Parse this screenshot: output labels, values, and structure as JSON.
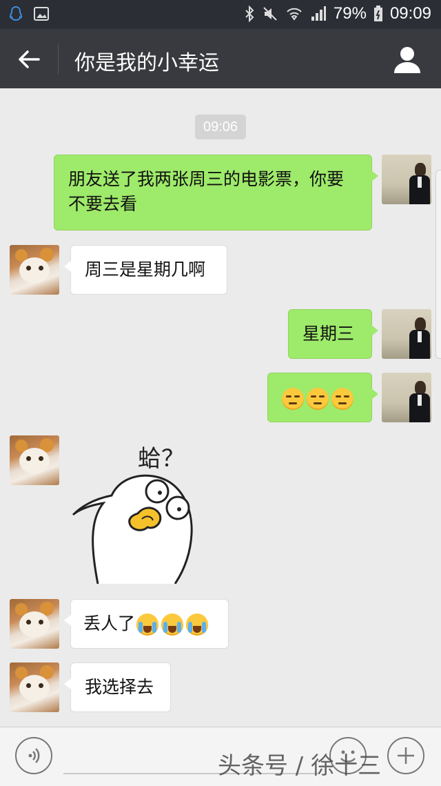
{
  "status_bar": {
    "battery": "79%",
    "time": "09:09",
    "icons": [
      "qq-icon",
      "image-icon",
      "bluetooth-icon",
      "mute-icon",
      "wifi-icon",
      "signal-icon",
      "battery-icon"
    ]
  },
  "header": {
    "title": "你是我的小幸运"
  },
  "chat": {
    "timestamp": "09:06",
    "messages": [
      {
        "side": "out",
        "text": "朋友送了我两张周三的电影票，你要不要去看"
      },
      {
        "side": "in",
        "text": "周三是星期几啊"
      },
      {
        "side": "out",
        "text": "星期三"
      },
      {
        "side": "out",
        "emoji": [
          "unamused-emoji",
          "unamused-emoji",
          "unamused-emoji"
        ]
      },
      {
        "side": "in",
        "sticker": "duck-sticker",
        "sticker_text": "蛤？"
      },
      {
        "side": "in",
        "text": "丢人了",
        "emoji": [
          "crying-laughing-emoji",
          "crying-laughing-emoji",
          "crying-laughing-emoji"
        ]
      },
      {
        "side": "in",
        "text": "我选择去"
      }
    ]
  },
  "bottom_bar": {
    "watermark": "头条号 / 徐十三"
  },
  "colors": {
    "outgoing_bubble": "#9eea6a",
    "incoming_bubble": "#ffffff",
    "header": "#393a3f",
    "chat_bg": "#ebebeb"
  }
}
